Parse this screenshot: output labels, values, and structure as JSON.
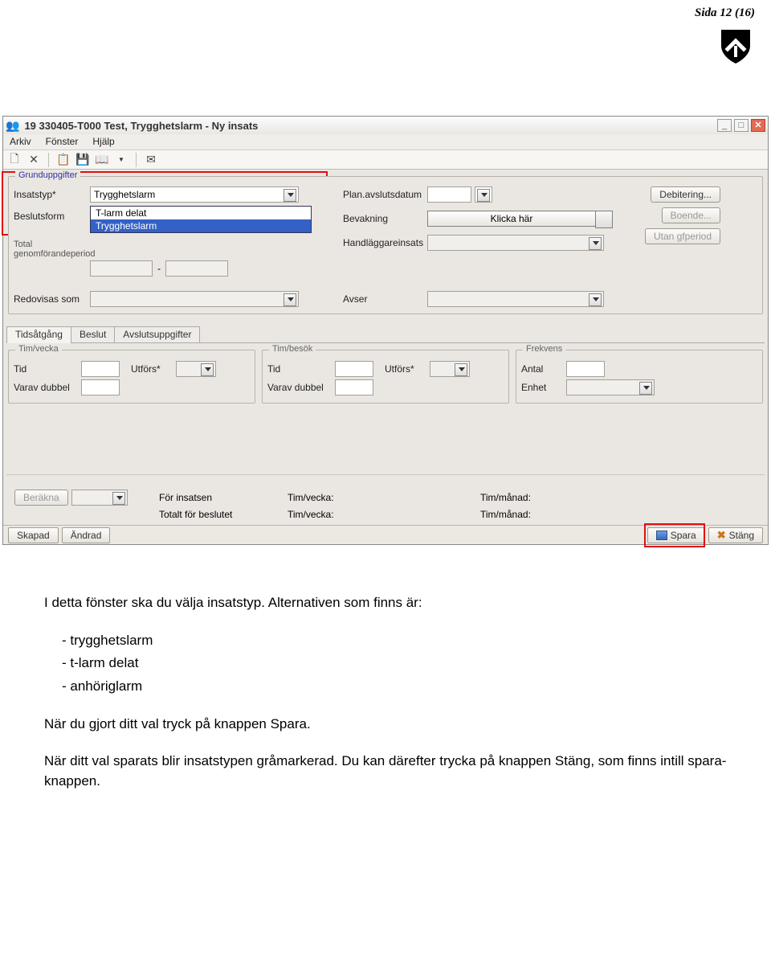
{
  "page_header": "Sida 12 (16)",
  "titlebar": {
    "text": "19 330405-T000   Test, Trygghetslarm   -   Ny insats"
  },
  "menubar": [
    "Arkiv",
    "Fönster",
    "Hjälp"
  ],
  "form": {
    "group_legend": "Grunduppgifter",
    "labels": {
      "insatstyp": "Insatstyp*",
      "beslutsform": "Beslutsform",
      "tot_period": "Total genomförandeperiod",
      "redovisas": "Redovisas som",
      "plan_avslut": "Plan.avslutsdatum",
      "bevakning": "Bevakning",
      "handlaggare": "Handläggareinsats",
      "avser": "Avser"
    },
    "insatstyp_value": "Trygghetslarm",
    "dd_options": [
      "T-larm delat",
      "Trygghetslarm"
    ],
    "klicka": "Klicka här",
    "right_buttons": {
      "debitering": "Debitering...",
      "boende": "Boende...",
      "utan": "Utan gfperiod"
    }
  },
  "tabs": [
    "Tidsåtgång",
    "Beslut",
    "Avslutsuppgifter"
  ],
  "panels": {
    "tv": {
      "legend": "Tim/vecka",
      "tid": "Tid",
      "utfors": "Utförs*",
      "dubbel": "Varav dubbel"
    },
    "tb": {
      "legend": "Tim/besök",
      "tid": "Tid",
      "utfors": "Utförs*",
      "dubbel": "Varav dubbel"
    },
    "fr": {
      "legend": "Frekvens",
      "antal": "Antal",
      "enhet": "Enhet"
    }
  },
  "bottom": {
    "berakna": "Beräkna",
    "for_insatsen": "För insatsen",
    "totalt": "Totalt för beslutet",
    "tv": "Tim/vecka:",
    "tm": "Tim/månad:"
  },
  "statusbar": {
    "skapad": "Skapad",
    "andrad": "Ändrad",
    "spara": "Spara",
    "stang": "Stäng"
  },
  "instructions": {
    "p1": "I detta fönster ska du välja insatstyp. Alternativen som finns är:",
    "li1": "trygghetslarm",
    "li2": "t-larm delat",
    "li3": "anhöriglarm",
    "p2": "När du gjort ditt val tryck på knappen Spara.",
    "p3": "När ditt val sparats blir insatstypen gråmarkerad. Du kan därefter trycka på knappen Stäng, som finns intill spara-knappen."
  }
}
